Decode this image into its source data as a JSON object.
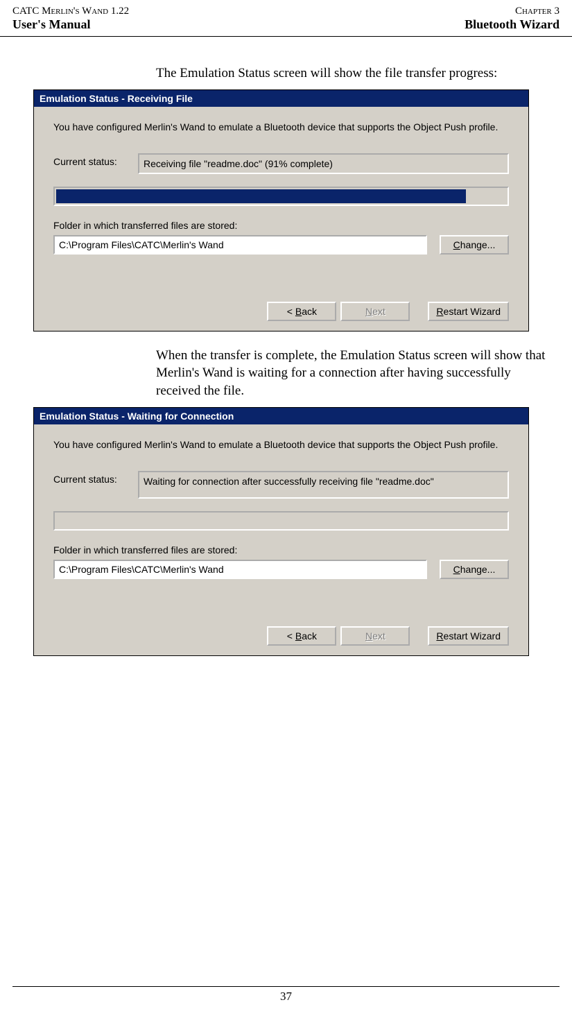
{
  "header": {
    "left_top": "CATC Merlin's Wand 1.22",
    "right_top": "Chapter 3",
    "left_bottom": "User's Manual",
    "right_bottom": "Bluetooth Wizard"
  },
  "para1": "The Emulation Status screen will show the file transfer progress:",
  "para2": "When the transfer is complete, the Emulation Status screen will show that Merlin's Wand is waiting for a connection after having successfully received the file.",
  "page_number": "37",
  "dialog1": {
    "title": "Emulation Status - Receiving File",
    "desc": "You have configured Merlin's Wand to emulate a Bluetooth device that supports the Object Push profile.",
    "status_label": "Current status:",
    "status_value": "Receiving file \"readme.doc\" (91% complete)",
    "progress_pct": 91,
    "folder_label": "Folder in which transferred files are stored:",
    "folder_value": "C:\\Program Files\\CATC\\Merlin's Wand",
    "change_btn": "Change...",
    "back_btn": "< Back",
    "next_btn": "Next",
    "restart_btn": "Restart Wizard"
  },
  "dialog2": {
    "title": "Emulation Status - Waiting for Connection",
    "desc": "You have configured Merlin's Wand to emulate a Bluetooth device that supports the Object Push profile.",
    "status_label": "Current status:",
    "status_value": "Waiting for connection after successfully receiving file \"readme.doc\"",
    "progress_pct": 0,
    "folder_label": "Folder in which transferred files are stored:",
    "folder_value": "C:\\Program Files\\CATC\\Merlin's Wand",
    "change_btn": "Change...",
    "back_btn": "< Back",
    "next_btn": "Next",
    "restart_btn": "Restart Wizard"
  }
}
